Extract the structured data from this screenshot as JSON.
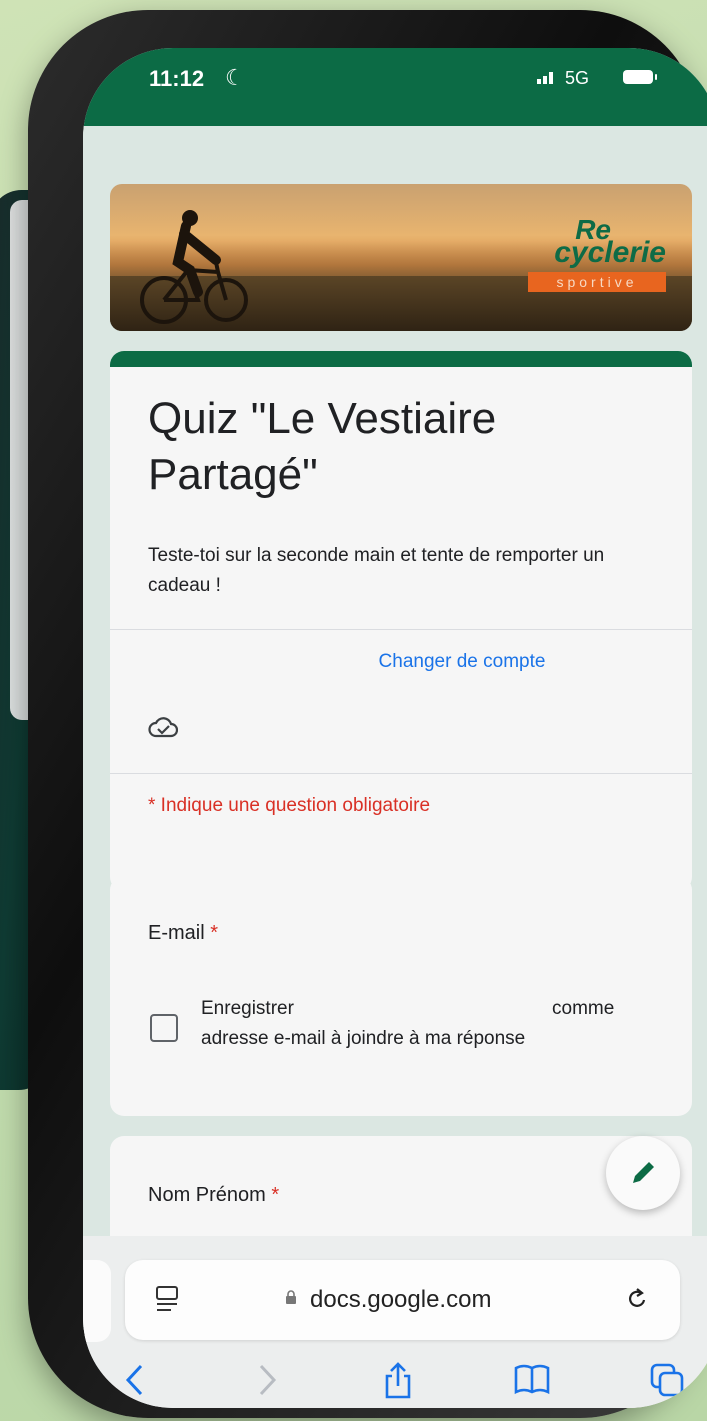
{
  "status_bar": {
    "time": "11:12",
    "moon_glyph": "☾",
    "signal_glyph": ".∣∣",
    "network": "5G"
  },
  "banner": {
    "logo_re": "Re",
    "logo_cyclerie": "cyclerie",
    "logo_sportive": "sportive"
  },
  "form": {
    "title": "Quiz \"Le Vestiaire Partagé\"",
    "description": "Teste-toi sur la seconde main et tente de remporter un cadeau !",
    "switch_account": "Changer de compte",
    "required_note": "* Indique une question obligatoire",
    "questions": [
      {
        "label": "E-mail",
        "required_marker": "*",
        "checkbox_text_start": "Enregistrer",
        "checkbox_text_end": "comme",
        "checkbox_text_line2": "adresse e-mail à joindre à ma réponse",
        "checked": false
      },
      {
        "label": "Nom Prénom",
        "required_marker": "*"
      }
    ]
  },
  "browser": {
    "url": "docs.google.com",
    "lock_glyph": "🔒"
  },
  "colors": {
    "brand_green": "#0c6b45",
    "link_blue": "#1a73e8",
    "required_red": "#d93025",
    "accent_orange": "#e8651f"
  },
  "icons": [
    "moon-icon",
    "signal-icon",
    "battery-icon",
    "cloud-check-icon",
    "checkbox-icon",
    "feedback-icon",
    "edit-icon",
    "reader-icon",
    "lock-icon",
    "reload-icon",
    "back-icon",
    "forward-icon",
    "share-icon",
    "bookmarks-icon",
    "tabs-icon"
  ]
}
